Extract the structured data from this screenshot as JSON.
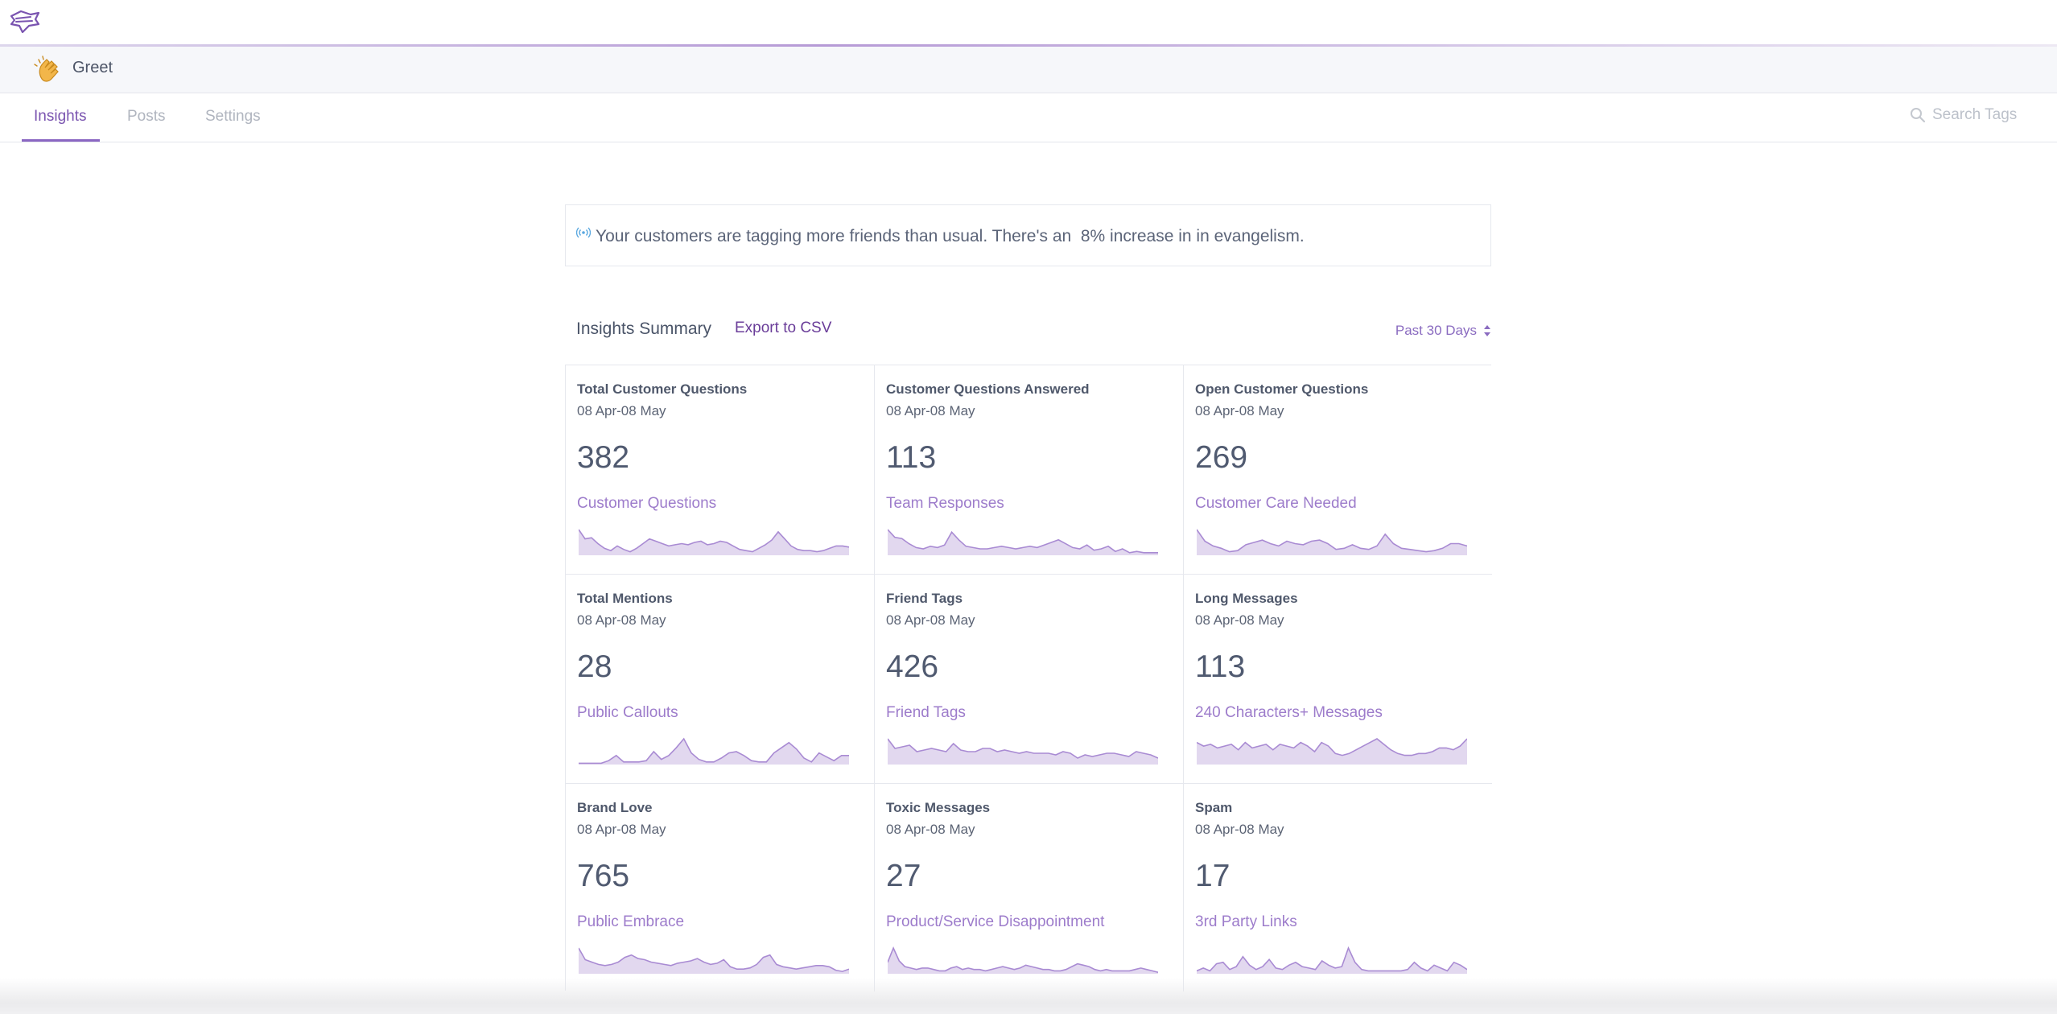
{
  "app": {
    "name": "Greet"
  },
  "tabs": [
    {
      "label": "Insights",
      "active": true
    },
    {
      "label": "Posts",
      "active": false
    },
    {
      "label": "Settings",
      "active": false
    }
  ],
  "search": {
    "placeholder": "Search Tags",
    "icon": "search-icon"
  },
  "notice": {
    "text": "Your customers are tagging more friends than usual. There's an  8% increase in in evangelism.",
    "icon": "broadcast-icon"
  },
  "summary": {
    "title": "Insights Summary",
    "export_label": "Export to CSV",
    "range_label": "Past 30 Days"
  },
  "colors": {
    "accent": "#7a54b0",
    "spark_fill": "#e2d8ef",
    "spark_line": "#a98bd3"
  },
  "cards": [
    {
      "title": "Total Customer Questions",
      "range": "08 Apr-08 May",
      "value": "382",
      "label": "Customer Questions",
      "series": [
        22,
        14,
        15,
        10,
        6,
        4,
        8,
        5,
        3,
        6,
        10,
        14,
        12,
        10,
        8,
        9,
        10,
        9,
        11,
        12,
        9,
        10,
        12,
        11,
        8,
        5,
        4,
        3,
        6,
        9,
        13,
        20,
        14,
        8,
        5,
        4,
        4,
        3,
        4,
        6,
        8,
        8,
        7
      ]
    },
    {
      "title": "Customer Questions Answered",
      "range": "08 Apr-08 May",
      "value": "113",
      "label": "Team Responses",
      "series": [
        20,
        14,
        13,
        9,
        6,
        5,
        7,
        6,
        8,
        18,
        12,
        7,
        6,
        5,
        5,
        6,
        7,
        6,
        5,
        6,
        7,
        6,
        8,
        10,
        12,
        9,
        6,
        5,
        8,
        4,
        5,
        7,
        3,
        5,
        2,
        3,
        2,
        2,
        2
      ]
    },
    {
      "title": "Open Customer Questions",
      "range": "08 Apr-08 May",
      "value": "269",
      "label": "Customer Care Needed",
      "series": [
        22,
        12,
        8,
        6,
        3,
        4,
        9,
        11,
        13,
        10,
        8,
        12,
        10,
        9,
        12,
        13,
        10,
        5,
        6,
        9,
        6,
        5,
        8,
        18,
        10,
        6,
        5,
        4,
        3,
        4,
        6,
        10,
        10,
        8
      ]
    },
    {
      "title": "Total Mentions",
      "range": "08 Apr-08 May",
      "value": "28",
      "label": "Public Callouts",
      "series": [
        1,
        1,
        1,
        1,
        3,
        7,
        2,
        2,
        2,
        3,
        10,
        4,
        7,
        13,
        20,
        9,
        4,
        2,
        2,
        5,
        9,
        10,
        7,
        3,
        2,
        2,
        9,
        13,
        17,
        12,
        5,
        2,
        9,
        6,
        3,
        7,
        7
      ]
    },
    {
      "title": "Friend Tags",
      "range": "08 Apr-08 May",
      "value": "426",
      "label": "Friend Tags",
      "series": [
        16,
        10,
        11,
        12,
        8,
        9,
        10,
        9,
        8,
        13,
        9,
        8,
        8,
        10,
        10,
        8,
        9,
        8,
        7,
        8,
        7,
        7,
        7,
        6,
        8,
        7,
        4,
        6,
        5,
        6,
        7,
        7,
        6,
        5,
        8,
        7,
        6,
        4
      ]
    },
    {
      "title": "Long Messages",
      "range": "08 Apr-08 May",
      "value": "113",
      "label": "240 Characters+ Messages",
      "series": [
        12,
        10,
        11,
        9,
        10,
        11,
        8,
        12,
        9,
        10,
        11,
        8,
        11,
        10,
        9,
        12,
        10,
        7,
        12,
        10,
        6,
        5,
        6,
        8,
        10,
        12,
        14,
        11,
        8,
        6,
        5,
        5,
        6,
        6,
        7,
        9,
        9,
        8,
        10,
        14
      ]
    },
    {
      "title": "Brand Love",
      "range": "08 Apr-08 May",
      "value": "765",
      "label": "Public Embrace",
      "series": [
        22,
        12,
        10,
        8,
        7,
        8,
        10,
        14,
        16,
        13,
        12,
        10,
        9,
        8,
        7,
        9,
        10,
        11,
        13,
        10,
        8,
        9,
        12,
        6,
        4,
        4,
        5,
        8,
        14,
        16,
        8,
        6,
        5,
        4,
        5,
        6,
        7,
        7,
        6,
        3,
        2,
        4
      ]
    },
    {
      "title": "Toxic Messages",
      "range": "08 Apr-08 May",
      "value": "27",
      "label": "Product/Service Disappointment",
      "series": [
        8,
        18,
        9,
        5,
        4,
        3,
        4,
        4,
        3,
        2,
        2,
        4,
        5,
        3,
        4,
        3,
        3,
        2,
        3,
        4,
        5,
        4,
        3,
        4,
        6,
        5,
        4,
        3,
        3,
        2,
        2,
        3,
        5,
        7,
        6,
        5,
        3,
        2,
        3,
        2,
        2,
        2,
        2,
        3,
        4,
        3,
        2,
        1
      ]
    },
    {
      "title": "Spam",
      "range": "08 Apr-08 May",
      "value": "17",
      "label": "3rd Party Links",
      "series": [
        2,
        4,
        2,
        7,
        8,
        3,
        5,
        12,
        6,
        3,
        5,
        10,
        4,
        3,
        6,
        8,
        5,
        4,
        3,
        9,
        6,
        4,
        5,
        18,
        8,
        3,
        2,
        2,
        2,
        2,
        2,
        2,
        3,
        8,
        4,
        2,
        6,
        4,
        2,
        8,
        6,
        3
      ]
    }
  ]
}
